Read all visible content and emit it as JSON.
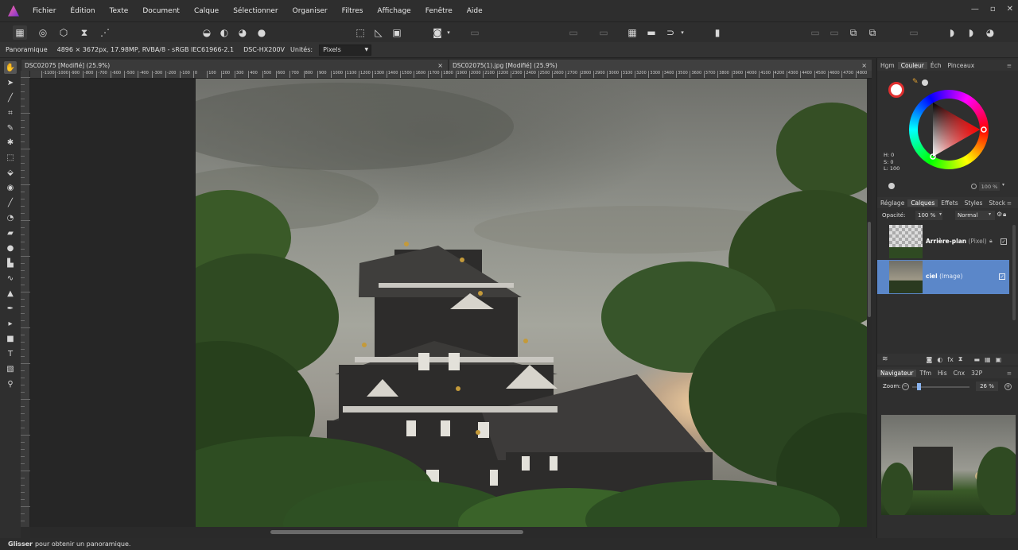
{
  "menu": [
    "Fichier",
    "Édition",
    "Texte",
    "Document",
    "Calque",
    "Sélectionner",
    "Organiser",
    "Filtres",
    "Affichage",
    "Fenêtre",
    "Aide"
  ],
  "window_controls": [
    "—",
    "▫",
    "✕"
  ],
  "context": {
    "tool_name": "Panoramique",
    "doc_info": "4896 × 3672px, 17.98MP, RVBA/8 - sRGB IEC61966-2.1",
    "camera": "DSC-HX200V",
    "units_label": "Unités:",
    "units_value": "Pixels"
  },
  "tabs": [
    {
      "label": "DSC02075 [Modifié] (25.9%)",
      "close": "×"
    },
    {
      "label": "DSC02075(1).jpg [Modifié] (25.9%)",
      "close": "×"
    }
  ],
  "ruler_labels": [
    "-1100",
    "-1000",
    "-900",
    "-800",
    "-700",
    "-600",
    "-500",
    "-400",
    "-300",
    "-200",
    "-100",
    "0",
    "100",
    "200",
    "300",
    "400",
    "500",
    "600",
    "700",
    "800",
    "900",
    "1000",
    "1100",
    "1200",
    "1300",
    "1400",
    "1500",
    "1600",
    "1700",
    "1800",
    "1900",
    "2000",
    "2100",
    "2200",
    "2300",
    "2400",
    "2500",
    "2600",
    "2700",
    "2800",
    "2900",
    "3000",
    "3100",
    "3200",
    "3300",
    "3400",
    "3500",
    "3600",
    "3700",
    "3800",
    "3900",
    "4000",
    "4100",
    "4200",
    "4300",
    "4400",
    "4500",
    "4600",
    "4700",
    "4800"
  ],
  "color_panel": {
    "tabs": [
      "Hgm",
      "Couleur",
      "Éch",
      "Pinceaux"
    ],
    "active": "Couleur",
    "h": "H: 0",
    "s": "S: 0",
    "l": "L: 100",
    "opacity": "100 %"
  },
  "layers_panel": {
    "tabs": [
      "Réglage",
      "Calques",
      "Effets",
      "Styles",
      "Stock"
    ],
    "active": "Calques",
    "opacity_label": "Opacité:",
    "opacity_value": "100 %",
    "blend_mode": "Normal",
    "layers": [
      {
        "name": "Arrière-plan",
        "type": "(Pixel)"
      },
      {
        "name": "ciel",
        "type": "(Image)"
      }
    ]
  },
  "navigator_panel": {
    "tabs": [
      "Navigateur",
      "Tfm",
      "His",
      "Cnx",
      "32P"
    ],
    "active": "Navigateur",
    "zoom_label": "Zoom:",
    "zoom_value": "26 %"
  },
  "status": {
    "bold": "Glisser",
    "text": "pour obtenir un panoramique."
  },
  "colors": {
    "selection": "#5b87c9",
    "accent_red": "#e0202a"
  }
}
